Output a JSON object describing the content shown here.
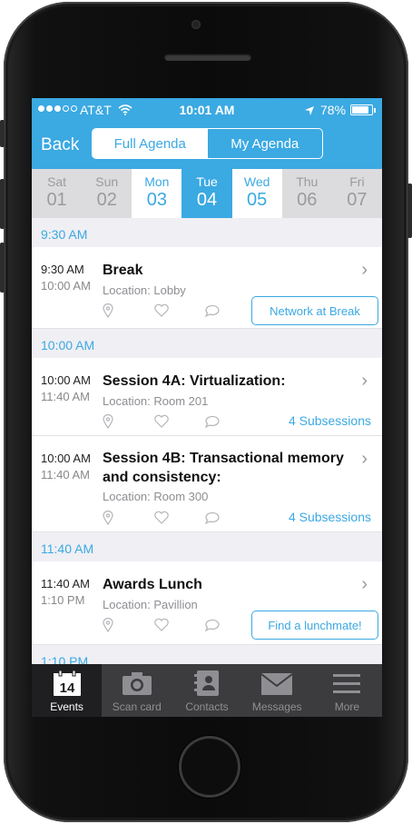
{
  "status": {
    "carrier": "AT&T",
    "time": "10:01 AM",
    "battery": "78%"
  },
  "nav": {
    "back_label": "Back",
    "segments": [
      {
        "label": "Full Agenda",
        "selected": true
      },
      {
        "label": "My Agenda",
        "selected": false
      }
    ]
  },
  "days": [
    {
      "name": "Sat",
      "num": "01",
      "state": "inactive"
    },
    {
      "name": "Sun",
      "num": "02",
      "state": "inactive"
    },
    {
      "name": "Mon",
      "num": "03",
      "state": "active"
    },
    {
      "name": "Tue",
      "num": "04",
      "state": "selected"
    },
    {
      "name": "Wed",
      "num": "05",
      "state": "active"
    },
    {
      "name": "Thu",
      "num": "06",
      "state": "inactive"
    },
    {
      "name": "Fri",
      "num": "07",
      "state": "inactive"
    }
  ],
  "sections": [
    {
      "time": "9:30 AM"
    },
    {
      "time": "10:00 AM"
    },
    {
      "time": "11:40 AM"
    },
    {
      "time": "1:10 PM"
    }
  ],
  "events": [
    {
      "start": "9:30 AM",
      "end": "10:00 AM",
      "title": "Break",
      "location": "Location: Lobby",
      "action": "Network at Break"
    },
    {
      "start": "10:00 AM",
      "end": "11:40 AM",
      "title": "Session 4A: Virtualization:",
      "location": "Location: Room 201",
      "subsessions": "4 Subsessions"
    },
    {
      "start": "10:00 AM",
      "end": "11:40 AM",
      "title": "Session 4B: Transactional memory and consistency:",
      "location": "Location: Room 300",
      "subsessions": "4 Subsessions"
    },
    {
      "start": "11:40 AM",
      "end": "1:10 PM",
      "title": "Awards Lunch",
      "location": "Location: Pavillion",
      "action": "Find a lunchmate!"
    }
  ],
  "tabbar": [
    {
      "label": "Events",
      "icon": "calendar-icon",
      "badge": "14",
      "selected": true
    },
    {
      "label": "Scan card",
      "icon": "camera-icon",
      "selected": false
    },
    {
      "label": "Contacts",
      "icon": "contacts-book-icon",
      "selected": false
    },
    {
      "label": "Messages",
      "icon": "envelope-icon",
      "selected": false
    },
    {
      "label": "More",
      "icon": "menu-icon",
      "selected": false
    }
  ],
  "colors": {
    "accent": "#3ba9e2",
    "tabbar": "#3c3c3e"
  }
}
